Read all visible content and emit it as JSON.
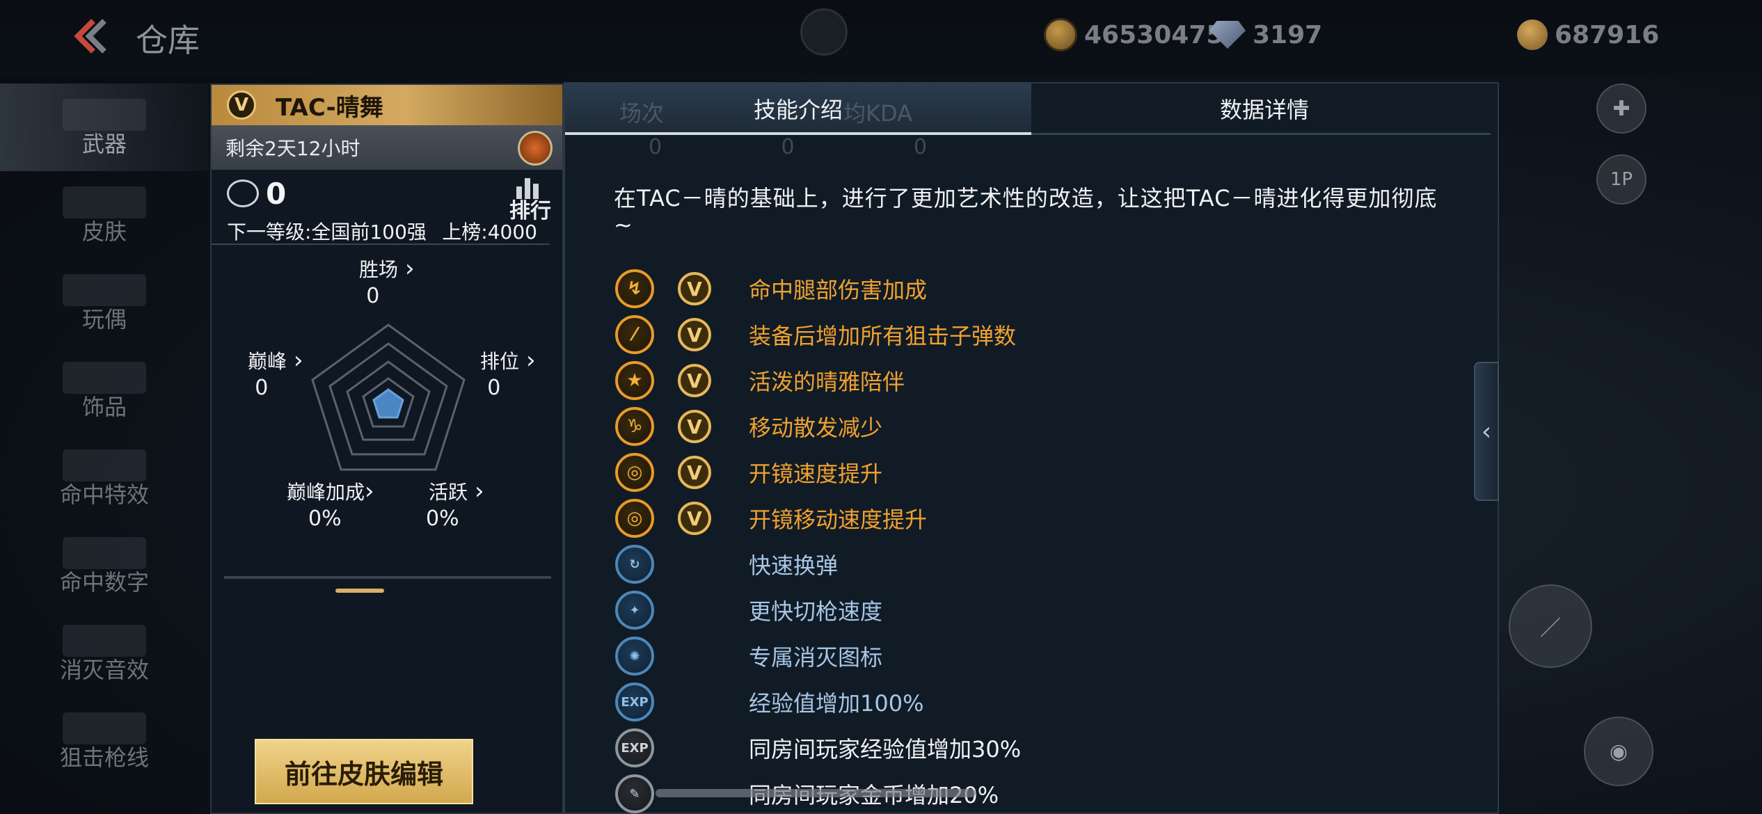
{
  "topbar": {
    "title": "仓库",
    "coins": "46530475",
    "diamonds": "3197",
    "points": "687916"
  },
  "nav": {
    "items": [
      {
        "label": "武器"
      },
      {
        "label": "皮肤"
      },
      {
        "label": "玩偶"
      },
      {
        "label": "饰品"
      },
      {
        "label": "命中特效"
      },
      {
        "label": "命中数字"
      },
      {
        "label": "消灭音效"
      },
      {
        "label": "狙击枪线"
      }
    ]
  },
  "card": {
    "name": "TAC-晴舞",
    "badge": "V",
    "remaining": "剩余2天12小时",
    "rank_value": "0",
    "rank_label": "排行",
    "next_level": "下一等级:全国前100强",
    "on_board": "上榜:4000",
    "stats": {
      "wins_label": "胜场",
      "wins": "0",
      "peak_label": "巅峰",
      "peak": "0",
      "ranked_label": "排位",
      "ranked": "0",
      "peak_bonus_label": "巅峰加成",
      "peak_bonus": "0%",
      "active_label": "活跃",
      "active": "0%"
    },
    "edit_button": "前往皮肤编辑"
  },
  "panel": {
    "tabs": [
      {
        "label": "技能介绍",
        "active": true
      },
      {
        "label": "数据详情",
        "active": false
      }
    ],
    "ghost_headers": [
      "场次",
      "均KDA",
      "0",
      "0",
      "0"
    ],
    "description": "在TAC－晴的基础上，进行了更加艺术性的改造，让这把TAC－晴进化得更加彻底~",
    "skills": [
      {
        "icon": "leg-hit-icon",
        "glyph": "↯",
        "style": "gold",
        "v": true,
        "text": "命中腿部伤害加成"
      },
      {
        "icon": "bullet-icon",
        "glyph": "⁄",
        "style": "gold",
        "v": true,
        "text": "装备后增加所有狙击子弹数"
      },
      {
        "icon": "star-icon",
        "glyph": "★",
        "style": "gold",
        "v": true,
        "text": "活泼的晴雅陪伴"
      },
      {
        "icon": "spread-icon",
        "glyph": "♑",
        "style": "gold",
        "v": true,
        "text": "移动散发减少"
      },
      {
        "icon": "scope-icon",
        "glyph": "◎",
        "style": "gold",
        "v": true,
        "text": "开镜速度提升"
      },
      {
        "icon": "scope-move-icon",
        "glyph": "◎",
        "style": "gold",
        "v": true,
        "text": "开镜移动速度提升"
      },
      {
        "icon": "reload-icon",
        "glyph": "↻",
        "style": "blue",
        "v": false,
        "text": "快速换弹"
      },
      {
        "icon": "switch-weapon-icon",
        "glyph": "✦",
        "style": "blue",
        "v": false,
        "text": "更快切枪速度"
      },
      {
        "icon": "kill-icon",
        "glyph": "✺",
        "style": "blue",
        "v": false,
        "text": "专属消灭图标"
      },
      {
        "icon": "exp-icon",
        "glyph": "EXP",
        "style": "blue",
        "v": false,
        "text": "经验值增加100%"
      },
      {
        "icon": "room-exp-icon",
        "glyph": "EXP",
        "style": "grey",
        "v": false,
        "text": "同房间玩家经验值增加30%"
      },
      {
        "icon": "room-gold-icon",
        "glyph": "✎",
        "style": "grey",
        "v": false,
        "text": "同房间玩家金币增加20%"
      }
    ],
    "v_label": "V"
  },
  "side": {
    "collapse_glyph": "‹",
    "player_label": "1P"
  },
  "colors": {
    "gold": "#f0a22e",
    "blue_text": "#a6c6e6",
    "accent_button": "#e2bd6b"
  }
}
